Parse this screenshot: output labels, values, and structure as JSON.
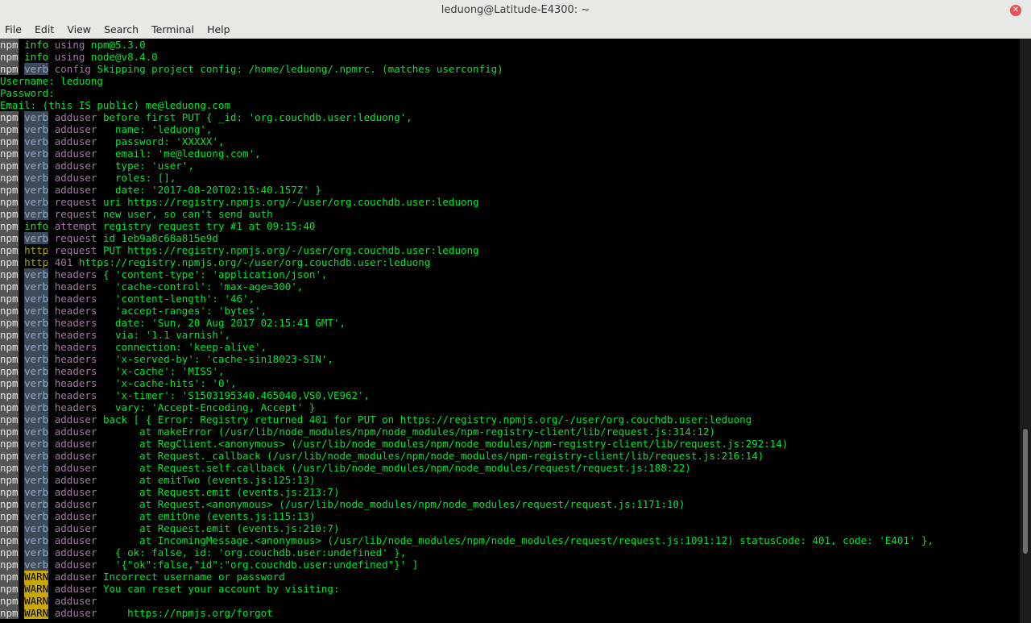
{
  "window": {
    "title": "leduong@Latitude-E4300: ~",
    "close_glyph": "✕"
  },
  "menu": [
    "File",
    "Edit",
    "View",
    "Search",
    "Terminal",
    "Help"
  ],
  "terminal": {
    "lines": [
      {
        "npm": "npm",
        "level": "info",
        "prefix": "using",
        "msg": "npm@5.3.0"
      },
      {
        "npm": "npm",
        "level": "info",
        "prefix": "using",
        "msg": "node@v8.4.0"
      },
      {
        "npm": "npm",
        "level": "verb",
        "prefix": "config",
        "msg": "Skipping project config: /home/leduong/.npmrc. (matches userconfig)"
      },
      {
        "text": "Username: leduong"
      },
      {
        "text": "Password:"
      },
      {
        "text": "Email: (this IS public) me@leduong.com"
      },
      {
        "npm": "npm",
        "level": "verb",
        "prefix": "adduser",
        "msg": "before first PUT { _id: 'org.couchdb.user:leduong',"
      },
      {
        "npm": "npm",
        "level": "verb",
        "prefix": "adduser",
        "msg": "  name: 'leduong',"
      },
      {
        "npm": "npm",
        "level": "verb",
        "prefix": "adduser",
        "msg": "  password: 'XXXXX',"
      },
      {
        "npm": "npm",
        "level": "verb",
        "prefix": "adduser",
        "msg": "  email: 'me@leduong.com',"
      },
      {
        "npm": "npm",
        "level": "verb",
        "prefix": "adduser",
        "msg": "  type: 'user',"
      },
      {
        "npm": "npm",
        "level": "verb",
        "prefix": "adduser",
        "msg": "  roles: [],"
      },
      {
        "npm": "npm",
        "level": "verb",
        "prefix": "adduser",
        "msg": "  date: '2017-08-20T02:15:40.157Z' }"
      },
      {
        "npm": "npm",
        "level": "verb",
        "prefix": "request",
        "msg": "uri https://registry.npmjs.org/-/user/org.couchdb.user:leduong"
      },
      {
        "npm": "npm",
        "level": "verb",
        "prefix": "request",
        "msg": "new user, so can't send auth"
      },
      {
        "npm": "npm",
        "level": "info",
        "prefix": "attempt",
        "msg": "registry request try #1 at 09:15:40"
      },
      {
        "npm": "npm",
        "level": "verb",
        "prefix": "request",
        "msg": "id 1eb9a8c68a815e9d"
      },
      {
        "npm": "npm",
        "level": "http",
        "prefix": "request",
        "msg": "PUT https://registry.npmjs.org/-/user/org.couchdb.user:leduong"
      },
      {
        "npm": "npm",
        "level": "http",
        "prefix": "401",
        "msg": "https://registry.npmjs.org/-/user/org.couchdb.user:leduong"
      },
      {
        "npm": "npm",
        "level": "verb",
        "prefix": "headers",
        "msg": "{ 'content-type': 'application/json',"
      },
      {
        "npm": "npm",
        "level": "verb",
        "prefix": "headers",
        "msg": "  'cache-control': 'max-age=300',"
      },
      {
        "npm": "npm",
        "level": "verb",
        "prefix": "headers",
        "msg": "  'content-length': '46',"
      },
      {
        "npm": "npm",
        "level": "verb",
        "prefix": "headers",
        "msg": "  'accept-ranges': 'bytes',"
      },
      {
        "npm": "npm",
        "level": "verb",
        "prefix": "headers",
        "msg": "  date: 'Sun, 20 Aug 2017 02:15:41 GMT',"
      },
      {
        "npm": "npm",
        "level": "verb",
        "prefix": "headers",
        "msg": "  via: '1.1 varnish',"
      },
      {
        "npm": "npm",
        "level": "verb",
        "prefix": "headers",
        "msg": "  connection: 'keep-alive',"
      },
      {
        "npm": "npm",
        "level": "verb",
        "prefix": "headers",
        "msg": "  'x-served-by': 'cache-sin18023-SIN',"
      },
      {
        "npm": "npm",
        "level": "verb",
        "prefix": "headers",
        "msg": "  'x-cache': 'MISS',"
      },
      {
        "npm": "npm",
        "level": "verb",
        "prefix": "headers",
        "msg": "  'x-cache-hits': '0',"
      },
      {
        "npm": "npm",
        "level": "verb",
        "prefix": "headers",
        "msg": "  'x-timer': 'S1503195340.465040,VS0,VE962',"
      },
      {
        "npm": "npm",
        "level": "verb",
        "prefix": "headers",
        "msg": "  vary: 'Accept-Encoding, Accept' }"
      },
      {
        "npm": "npm",
        "level": "verb",
        "prefix": "adduser",
        "msg": "back [ { Error: Registry returned 401 for PUT on https://registry.npmjs.org/-/user/org.couchdb.user:leduong"
      },
      {
        "npm": "npm",
        "level": "verb",
        "prefix": "adduser",
        "msg": "      at makeError (/usr/lib/node_modules/npm/node_modules/npm-registry-client/lib/request.js:314:12)"
      },
      {
        "npm": "npm",
        "level": "verb",
        "prefix": "adduser",
        "msg": "      at RegClient.<anonymous> (/usr/lib/node_modules/npm/node_modules/npm-registry-client/lib/request.js:292:14)"
      },
      {
        "npm": "npm",
        "level": "verb",
        "prefix": "adduser",
        "msg": "      at Request._callback (/usr/lib/node_modules/npm/node_modules/npm-registry-client/lib/request.js:216:14)"
      },
      {
        "npm": "npm",
        "level": "verb",
        "prefix": "adduser",
        "msg": "      at Request.self.callback (/usr/lib/node_modules/npm/node_modules/request/request.js:188:22)"
      },
      {
        "npm": "npm",
        "level": "verb",
        "prefix": "adduser",
        "msg": "      at emitTwo (events.js:125:13)"
      },
      {
        "npm": "npm",
        "level": "verb",
        "prefix": "adduser",
        "msg": "      at Request.emit (events.js:213:7)"
      },
      {
        "npm": "npm",
        "level": "verb",
        "prefix": "adduser",
        "msg": "      at Request.<anonymous> (/usr/lib/node_modules/npm/node_modules/request/request.js:1171:10)"
      },
      {
        "npm": "npm",
        "level": "verb",
        "prefix": "adduser",
        "msg": "      at emitOne (events.js:115:13)"
      },
      {
        "npm": "npm",
        "level": "verb",
        "prefix": "adduser",
        "msg": "      at Request.emit (events.js:210:7)"
      },
      {
        "npm": "npm",
        "level": "verb",
        "prefix": "adduser",
        "msg": "      at IncomingMessage.<anonymous> (/usr/lib/node_modules/npm/node_modules/request/request.js:1091:12) statusCode: 401, code: 'E401' },"
      },
      {
        "npm": "npm",
        "level": "verb",
        "prefix": "adduser",
        "msg": "  { ok: false, id: 'org.couchdb.user:undefined' },"
      },
      {
        "npm": "npm",
        "level": "verb",
        "prefix": "adduser",
        "msg": "  '{\"ok\":false,\"id\":\"org.couchdb.user:undefined\"}' ]"
      },
      {
        "npm": "npm",
        "level": "WARN",
        "prefix": "adduser",
        "msg": "Incorrect username or password"
      },
      {
        "npm": "npm",
        "level": "WARN",
        "prefix": "adduser",
        "msg": "You can reset your account by visiting:"
      },
      {
        "npm": "npm",
        "level": "WARN",
        "prefix": "adduser",
        "msg": ""
      },
      {
        "npm": "npm",
        "level": "WARN",
        "prefix": "adduser",
        "msg": "    https://npmjs.org/forgot"
      }
    ]
  }
}
